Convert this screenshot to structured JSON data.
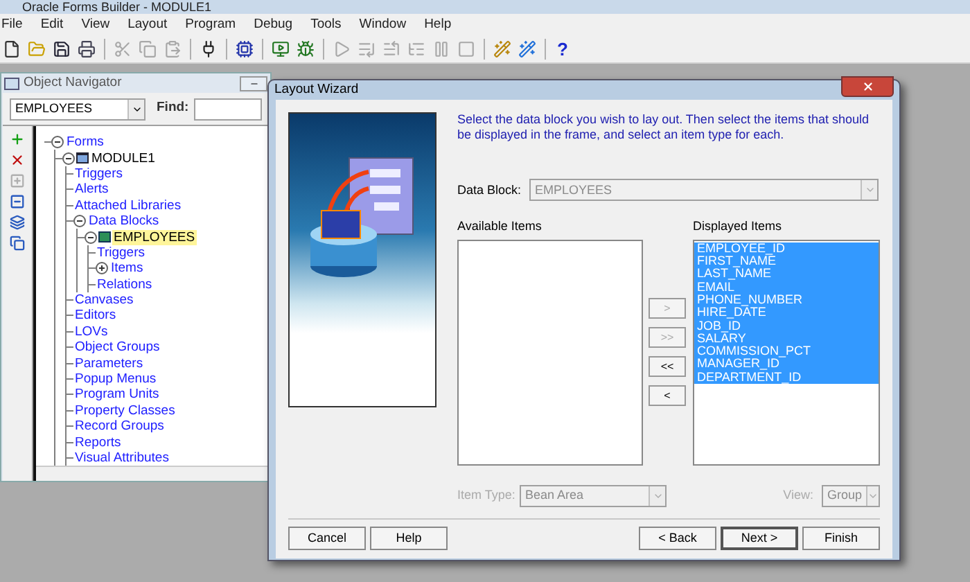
{
  "app_window": {
    "title": "Oracle Forms Builder - MODULE1"
  },
  "menu": [
    "File",
    "Edit",
    "View",
    "Layout",
    "Program",
    "Debug",
    "Tools",
    "Window",
    "Help"
  ],
  "toolbar": [
    {
      "kind": "icon",
      "disabled": false
    },
    {
      "kind": "icon",
      "disabled": false
    },
    {
      "kind": "icon",
      "disabled": false
    },
    {
      "kind": "icon",
      "disabled": false
    },
    {
      "kind": "sep"
    },
    {
      "kind": "icon",
      "disabled": true
    },
    {
      "kind": "icon",
      "disabled": true
    },
    {
      "kind": "icon",
      "disabled": true
    },
    {
      "kind": "sep"
    },
    {
      "kind": "icon",
      "disabled": false
    },
    {
      "kind": "sep"
    },
    {
      "kind": "icon",
      "disabled": false
    },
    {
      "kind": "sep"
    },
    {
      "kind": "icon",
      "disabled": false
    },
    {
      "kind": "icon",
      "disabled": false
    },
    {
      "kind": "sep"
    },
    {
      "kind": "icon",
      "disabled": true
    },
    {
      "kind": "icon",
      "disabled": true
    },
    {
      "kind": "icon",
      "disabled": true
    },
    {
      "kind": "icon",
      "disabled": true
    },
    {
      "kind": "icon",
      "disabled": true
    },
    {
      "kind": "icon",
      "disabled": true
    },
    {
      "kind": "sep"
    },
    {
      "kind": "icon",
      "disabled": false
    },
    {
      "kind": "icon",
      "disabled": false
    },
    {
      "kind": "sep"
    },
    {
      "kind": "text",
      "label": "?",
      "disabled": false
    }
  ],
  "navigator": {
    "title": "Object Navigator",
    "block_select": "EMPLOYEES",
    "find_label": "Find:",
    "tools": [
      {
        "disabled": false
      },
      {
        "disabled": false
      },
      {
        "disabled": true
      },
      {
        "disabled": false
      },
      {
        "disabled": false
      },
      {
        "disabled": false
      }
    ],
    "tree": [
      {
        "label": "Forms",
        "expanded": true,
        "selected": false,
        "children": [
          {
            "label": "MODULE1",
            "kind": "module",
            "expanded": true,
            "selected": false,
            "children": [
              {
                "label": "Triggers",
                "selected": false
              },
              {
                "label": "Alerts",
                "selected": false
              },
              {
                "label": "Attached Libraries",
                "selected": false
              },
              {
                "label": "Data Blocks",
                "expanded": true,
                "selected": false,
                "children": [
                  {
                    "label": "EMPLOYEES",
                    "kind": "block",
                    "expanded": true,
                    "selected": true,
                    "children": [
                      {
                        "label": "Triggers",
                        "selected": false
                      },
                      {
                        "label": "Items",
                        "expanded": false,
                        "selected": false
                      },
                      {
                        "label": "Relations",
                        "selected": false
                      }
                    ]
                  }
                ]
              },
              {
                "label": "Canvases",
                "selected": false
              },
              {
                "label": "Editors",
                "selected": false
              },
              {
                "label": "LOVs",
                "selected": false
              },
              {
                "label": "Object Groups",
                "selected": false
              },
              {
                "label": "Parameters",
                "selected": false
              },
              {
                "label": "Popup Menus",
                "selected": false
              },
              {
                "label": "Program Units",
                "selected": false
              },
              {
                "label": "Property Classes",
                "selected": false
              },
              {
                "label": "Record Groups",
                "selected": false
              },
              {
                "label": "Reports",
                "selected": false
              },
              {
                "label": "Visual Attributes",
                "selected": false
              }
            ]
          }
        ]
      }
    ]
  },
  "wizard": {
    "title": "Layout Wizard",
    "description": "Select the data block you wish to lay out. Then select the items that should be displayed in the frame, and select an item type for each.",
    "data_block_label": "Data Block:",
    "data_block_value": "EMPLOYEES",
    "data_block_disabled": true,
    "available_label": "Available Items",
    "displayed_label": "Displayed Items",
    "displayed_items": [
      {
        "label": "EMPLOYEE_ID",
        "selected": true
      },
      {
        "label": "FIRST_NAME",
        "selected": true
      },
      {
        "label": "LAST_NAME",
        "selected": true
      },
      {
        "label": "EMAIL",
        "selected": true
      },
      {
        "label": "PHONE_NUMBER",
        "selected": true
      },
      {
        "label": "HIRE_DATE",
        "selected": true
      },
      {
        "label": "JOB_ID",
        "selected": true
      },
      {
        "label": "SALARY",
        "selected": true
      },
      {
        "label": "COMMISSION_PCT",
        "selected": true
      },
      {
        "label": "MANAGER_ID",
        "selected": true
      },
      {
        "label": "DEPARTMENT_ID",
        "selected": true
      }
    ],
    "move_buttons": [
      {
        "label": ">",
        "disabled": true
      },
      {
        "label": ">>",
        "disabled": true
      },
      {
        "label": "<<",
        "disabled": false
      },
      {
        "label": "<",
        "disabled": false
      }
    ],
    "item_type_label": "Item Type:",
    "item_type_value": "Bean Area",
    "item_type_disabled": true,
    "view_label": "View:",
    "view_value": "Group",
    "view_disabled": true,
    "buttons_left": [
      "Cancel",
      "Help"
    ],
    "buttons_right": [
      {
        "label": "< Back",
        "default": false
      },
      {
        "label": "Next >",
        "default": true
      },
      {
        "label": "Finish",
        "default": false
      }
    ]
  }
}
